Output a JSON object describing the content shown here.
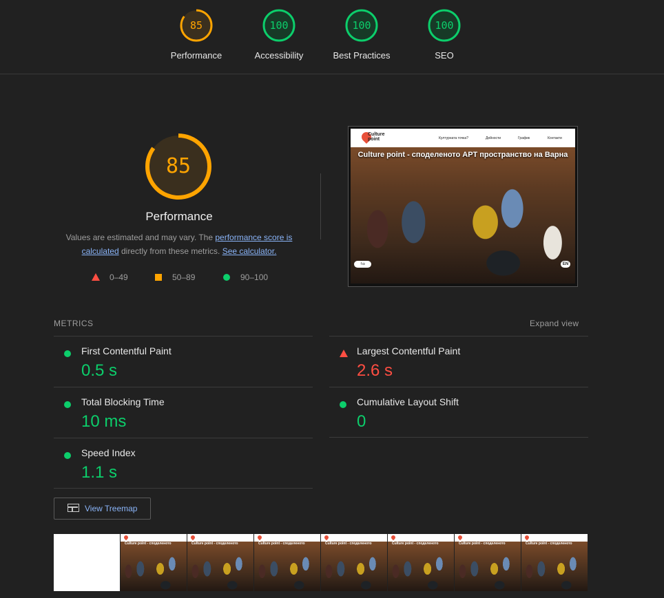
{
  "colors": {
    "pass": "#0cce6b",
    "average": "#ffa400",
    "fail": "#ff4e42",
    "link": "#8ab4f8"
  },
  "categories": [
    {
      "score": 85,
      "label": "Performance",
      "rating": "average"
    },
    {
      "score": 100,
      "label": "Accessibility",
      "rating": "pass"
    },
    {
      "score": 100,
      "label": "Best Practices",
      "rating": "pass"
    },
    {
      "score": 100,
      "label": "SEO",
      "rating": "pass"
    }
  ],
  "performance": {
    "score": 85,
    "title": "Performance",
    "desc_prefix": "Values are estimated and may vary. The ",
    "link_score": "performance score is calculated",
    "desc_middle": " directly from these metrics. ",
    "link_calc": "See calculator."
  },
  "legend": {
    "fail": "0–49",
    "average": "50–89",
    "pass": "90–100"
  },
  "screenshot": {
    "logo_line1": "Culture",
    "logo_line2": "point",
    "nav": [
      "Културната точка?",
      "Дейности",
      "График",
      "Контакти"
    ],
    "hero": "Culture point - споделеното АРТ пространство на Варна",
    "social": "f ◘",
    "lang": "EN"
  },
  "metrics": {
    "title": "METRICS",
    "expand": "Expand view",
    "items": [
      {
        "name": "First Contentful Paint",
        "value": "0.5 s",
        "rating": "pass"
      },
      {
        "name": "Largest Contentful Paint",
        "value": "2.6 s",
        "rating": "fail"
      },
      {
        "name": "Total Blocking Time",
        "value": "10 ms",
        "rating": "pass"
      },
      {
        "name": "Cumulative Layout Shift",
        "value": "0",
        "rating": "pass"
      },
      {
        "name": "Speed Index",
        "value": "1.1 s",
        "rating": "pass"
      }
    ]
  },
  "treemap": {
    "label": "View Treemap"
  },
  "filmstrip": {
    "frame_text": "Culture point - споделеното"
  }
}
